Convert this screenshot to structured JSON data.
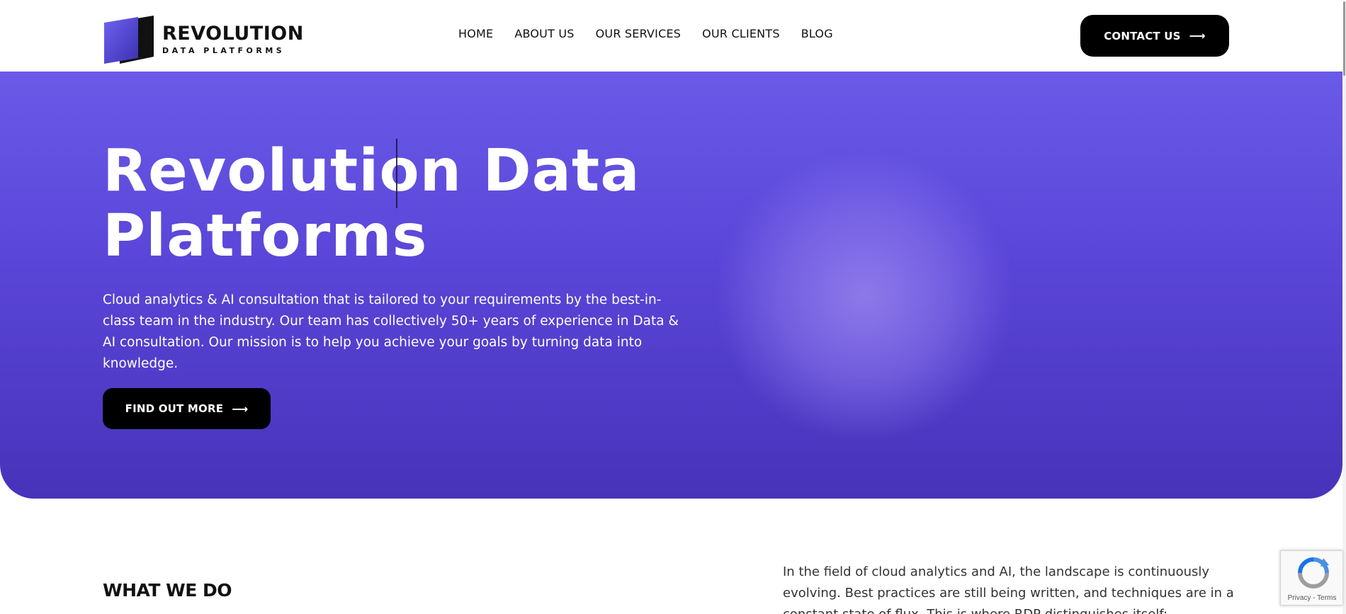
{
  "header": {
    "logo": {
      "title": "REVOLUTION",
      "subtitle": "DATA PLATFORMS"
    },
    "nav": [
      {
        "label": "HOME"
      },
      {
        "label": "ABOUT US"
      },
      {
        "label": "OUR SERVICES"
      },
      {
        "label": "OUR CLIENTS"
      },
      {
        "label": "BLOG"
      }
    ],
    "contact_label": "CONTACT US",
    "arrow_glyph": "⟶"
  },
  "hero": {
    "title_line1": "Revolution Data",
    "title_line2": "Platforms",
    "description": "Cloud analytics & AI consultation that is tailored to your requirements by the best-in-class team in the industry. Our team has collectively 50+ years of experience in Data & AI consultation. Our mission is to help you achieve your goals by turning data into knowledge.",
    "cta_label": "FIND OUT MORE"
  },
  "section": {
    "heading": "WHAT WE DO",
    "intro": "In the field of cloud analytics and AI, the landscape is continuously evolving. Best practices are still being written, and techniques are in a constant state of flux. This is where RDP distinguishes itself:"
  },
  "recaptcha": {
    "footer": "Privacy - Terms"
  },
  "colors": {
    "hero_top": "#6a5ae8",
    "hero_bottom": "#4733b9",
    "button_bg": "#000000",
    "accent_text": "#ffffff"
  }
}
